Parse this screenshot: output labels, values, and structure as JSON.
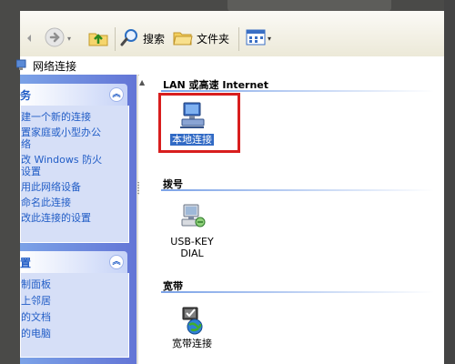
{
  "toolbar": {
    "search_label": "搜索",
    "folders_label": "文件夹"
  },
  "address": {
    "text": "网络连接"
  },
  "taskpane": {
    "group1": {
      "title": "务",
      "items": [
        "建一个新的连接",
        "置家庭或小型办公络",
        "改 Windows 防火设置",
        "用此网络设备",
        "命名此连接",
        "改此连接的设置"
      ]
    },
    "group2": {
      "title": "置",
      "items": [
        "制面板",
        "上邻居",
        "的文档",
        "的电脑"
      ]
    }
  },
  "main": {
    "sections": [
      {
        "title": "LAN 或高速 Internet"
      },
      {
        "title": "拨号"
      },
      {
        "title": "宽带"
      }
    ],
    "connections": {
      "lan": "本地连接",
      "dial_line1": "USB-KEY",
      "dial_line2": "DIAL",
      "broadband": "宽带连接"
    }
  },
  "colors": {
    "pane_blue": "#6f8ee0",
    "link_blue": "#215dc6",
    "highlight_red": "#d81e1e",
    "selection": "#316ac5"
  },
  "icons": [
    "back-arrow-icon",
    "forward-arrow-icon",
    "up-folder-icon",
    "search-icon",
    "folder-icon",
    "views-icon",
    "network-connection-icon",
    "dialup-connection-icon",
    "broadband-connection-icon",
    "chevron-up-icon"
  ]
}
